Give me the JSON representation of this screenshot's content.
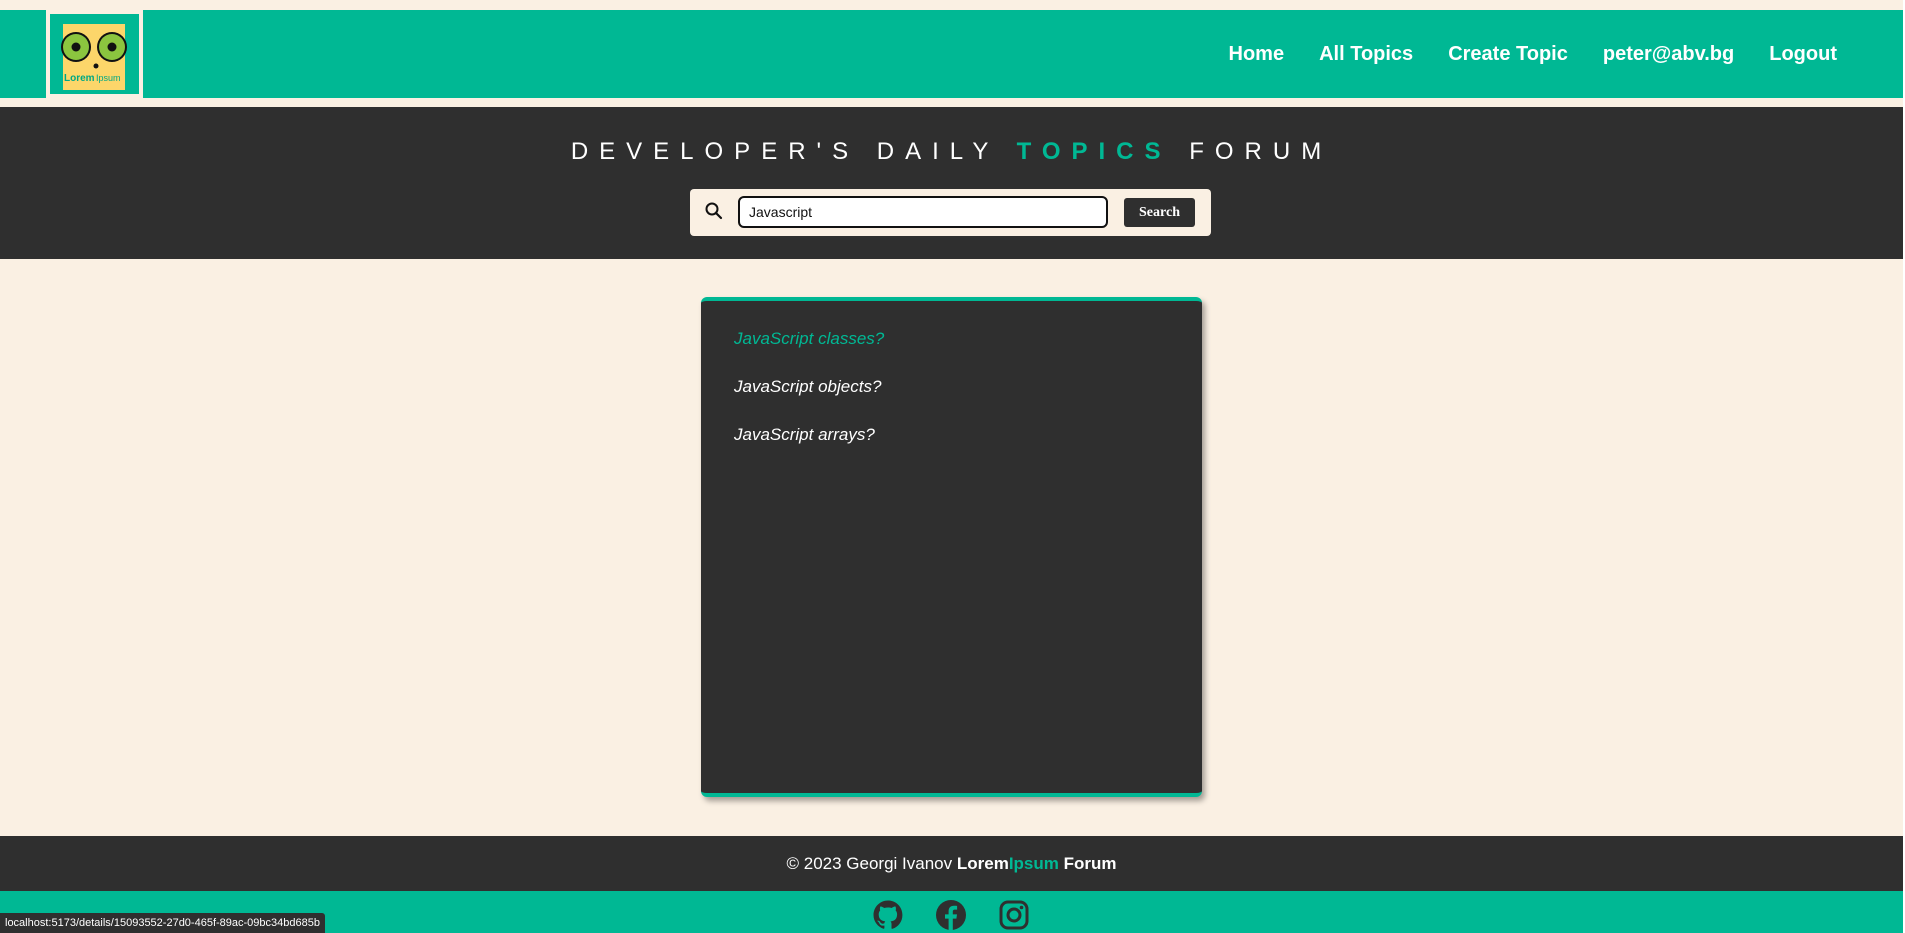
{
  "logo": {
    "text_main": "Lorem",
    "text_accent": "Ipsum"
  },
  "nav": {
    "items": [
      {
        "label": "Home"
      },
      {
        "label": "All Topics"
      },
      {
        "label": "Create Topic"
      },
      {
        "label": "peter@abv.bg"
      },
      {
        "label": "Logout"
      }
    ]
  },
  "hero": {
    "title_part1": "DEVELOPER'S DAILY",
    "title_accent": "TOPICS",
    "title_part2": "FORUM"
  },
  "search": {
    "value": "Javascript",
    "button_label": "Search"
  },
  "topics": [
    {
      "title": "JavaScript classes?",
      "state": "hovered"
    },
    {
      "title": "JavaScript objects?",
      "state": "normal"
    },
    {
      "title": "JavaScript arrays?",
      "state": "normal"
    }
  ],
  "footer": {
    "copyright": "© 2023 Georgi Ivanov",
    "brand_main": "Lorem",
    "brand_accent": "Ipsum",
    "brand_suffix": "Forum"
  },
  "social": [
    {
      "icon": "github-icon"
    },
    {
      "icon": "facebook-icon"
    },
    {
      "icon": "instagram-icon"
    }
  ],
  "status_bar": {
    "url": "localhost:5173/details/15093552-27d0-465f-89ac-09bc34bd685b"
  },
  "colors": {
    "accent": "#00b894",
    "dark": "#2f2f2f",
    "background": "#faf0e3"
  }
}
